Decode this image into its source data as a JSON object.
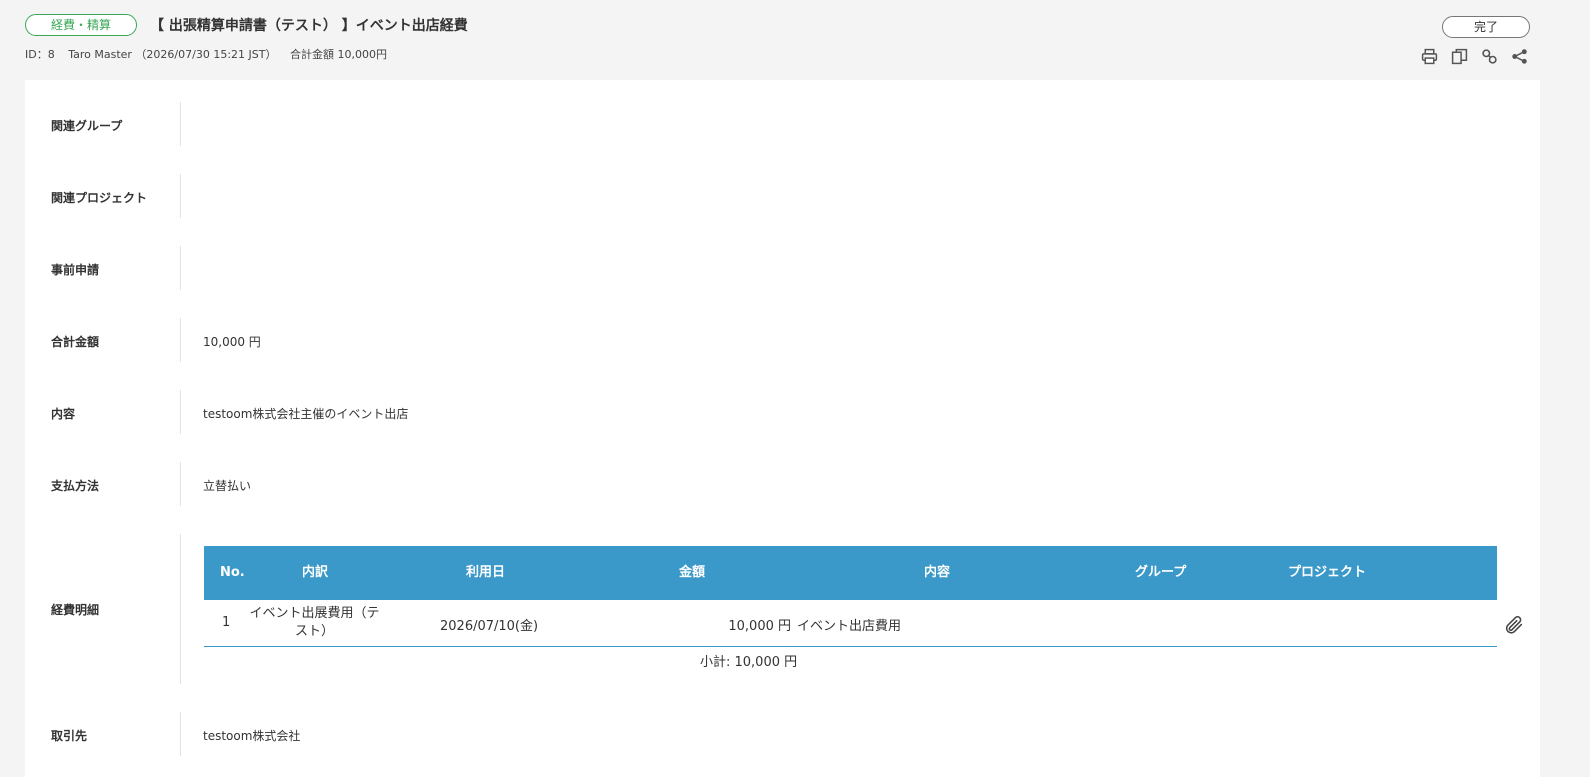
{
  "header": {
    "category": "経費・精算",
    "title": "【 出張精算申請書（テスト） 】イベント出店経費",
    "meta": {
      "id": "ID：8",
      "user": "Taro Master （2026/07/30 15:21 JST）",
      "total": "合計金額 10,000円"
    },
    "status": "完了",
    "toolbar_icons": [
      "print-icon",
      "copy-icon",
      "link-icon",
      "share-icon"
    ]
  },
  "fields": [
    {
      "label": "関連グループ",
      "value": ""
    },
    {
      "label": "関連プロジェクト",
      "value": ""
    },
    {
      "label": "事前申請",
      "value": ""
    },
    {
      "label": "合計金額",
      "value": "10,000 円"
    },
    {
      "label": "内容",
      "value": "testoom株式会社主催のイベント出店"
    },
    {
      "label": "支払方法",
      "value": "立替払い"
    },
    {
      "label": "経費明細",
      "value": ""
    },
    {
      "label": "取引先",
      "value": "testoom株式会社"
    }
  ],
  "expense_table": {
    "headers": [
      "No.",
      "内訳",
      "利用日",
      "金額",
      "内容",
      "グループ",
      "プロジェクト"
    ],
    "rows": [
      {
        "no": "1",
        "item_line1": "イベント出展費用（テ",
        "item_line2": "スト）",
        "date": "2026/07/10(金)",
        "amount": "10,000 円",
        "content": "イベント出店費用",
        "group": "",
        "project": ""
      }
    ],
    "subtotal": "小計: 10,000 円",
    "attachment_icon": "paperclip-icon"
  },
  "colors": {
    "badge_green": "#3aa757",
    "table_header_blue": "#3b99c9",
    "page_background": "#f4f4f4"
  }
}
